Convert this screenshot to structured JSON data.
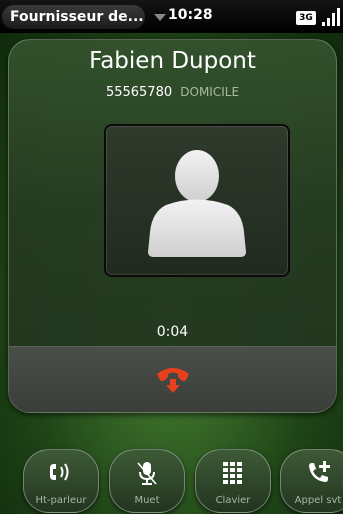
{
  "status_bar": {
    "carrier": "Fournisseur de...",
    "time": "10:28",
    "network": "3G"
  },
  "call": {
    "contact_name": "Fabien Dupont",
    "number": "55565780",
    "number_label": "DOMICILE",
    "duration": "0:04"
  },
  "actions": [
    {
      "label": "Ht-parleur",
      "icon": "speaker-icon"
    },
    {
      "label": "Muet",
      "icon": "microphone-mute-icon"
    },
    {
      "label": "Clavier",
      "icon": "keypad-icon"
    },
    {
      "label": "Appel svt",
      "icon": "add-call-icon"
    }
  ],
  "colors": {
    "end_call": "#e8401c",
    "background_green": "#2f5b23"
  }
}
